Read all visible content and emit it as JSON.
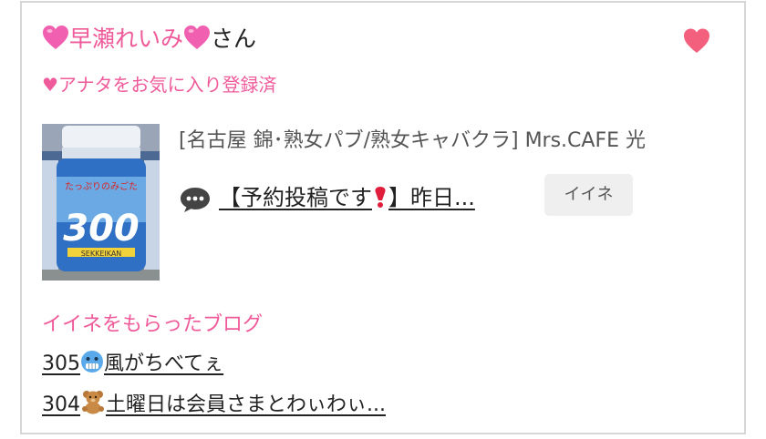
{
  "header": {
    "name": "早瀬れいみ",
    "suffix": "さん",
    "name_emoji": "pink-heart-icon",
    "favorite_icon": "heart-icon",
    "favorite_status": "♥アナタをお気に入り登録済"
  },
  "post": {
    "thumbnail_icon": "bottled-drink-photo",
    "shop": "[名古屋 錦･熟女パブ/熟女キャバクラ]  Mrs.CAFE 光",
    "comment_icon": "speech-bubble-icon",
    "title_before": "【予約投稿です",
    "title_after": "】昨日...",
    "title_emoji": "red-exclamation-icon",
    "like_button": "イイネ"
  },
  "liked_blogs": {
    "heading": "イイネをもらったブログ",
    "items": [
      {
        "prefix": "305",
        "icon": "cold-face-icon",
        "text": "風がちべてぇ"
      },
      {
        "prefix": "304",
        "icon": "teddy-bear-icon",
        "text": "土曜日は会員さまとわぃわぃ..."
      }
    ]
  },
  "colors": {
    "accent_pink": "#ef5a9a",
    "heart": "#f2607d",
    "text": "#222222"
  }
}
